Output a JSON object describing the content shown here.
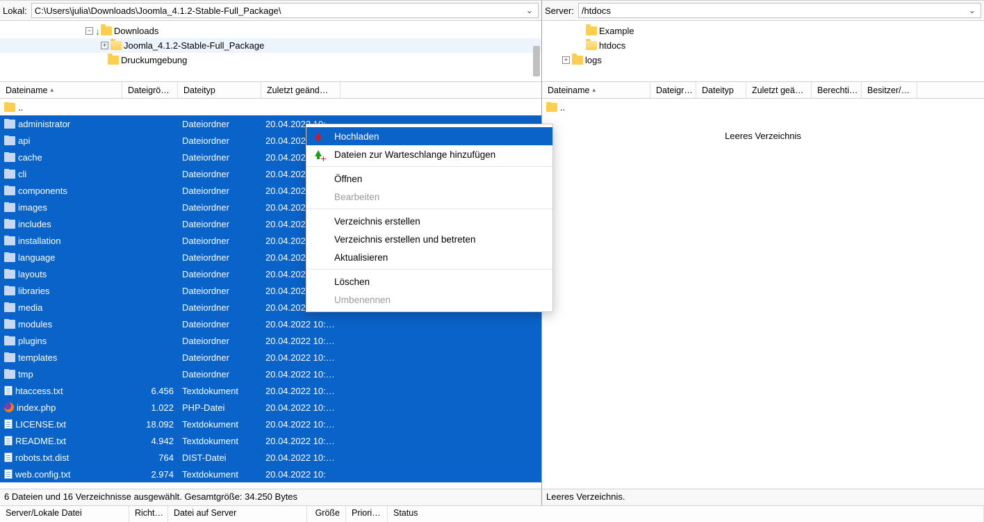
{
  "local": {
    "path_label": "Lokal:",
    "path": "C:\\Users\\julia\\Downloads\\Joomla_4.1.2-Stable-Full_Package\\",
    "tree": [
      {
        "indent": 120,
        "twist": "−",
        "dl": true,
        "label": "Downloads"
      },
      {
        "indent": 142,
        "twist": "+",
        "icon": "folder-open",
        "label": "Joomla_4.1.2-Stable-Full_Package",
        "selected": true
      },
      {
        "indent": 152,
        "label": "Druckumgebung"
      }
    ],
    "cols": {
      "name": "Dateiname",
      "size": "Dateigrö…",
      "type": "Dateityp",
      "modified": "Zuletzt geänd…"
    },
    "parent_row": "..",
    "rows": [
      {
        "icon": "folder",
        "name": "administrator",
        "type": "Dateiordner",
        "mod": "20.04.2022 10:"
      },
      {
        "icon": "folder",
        "name": "api",
        "type": "Dateiordner",
        "mod": "20.04.202"
      },
      {
        "icon": "folder",
        "name": "cache",
        "type": "Dateiordner",
        "mod": "20.04.202"
      },
      {
        "icon": "folder",
        "name": "cli",
        "type": "Dateiordner",
        "mod": "20.04.202"
      },
      {
        "icon": "folder",
        "name": "components",
        "type": "Dateiordner",
        "mod": "20.04.202"
      },
      {
        "icon": "folder",
        "name": "images",
        "type": "Dateiordner",
        "mod": "20.04.202"
      },
      {
        "icon": "folder",
        "name": "includes",
        "type": "Dateiordner",
        "mod": "20.04.202"
      },
      {
        "icon": "folder",
        "name": "installation",
        "type": "Dateiordner",
        "mod": "20.04.202"
      },
      {
        "icon": "folder",
        "name": "language",
        "type": "Dateiordner",
        "mod": "20.04.202"
      },
      {
        "icon": "folder",
        "name": "layouts",
        "type": "Dateiordner",
        "mod": "20.04.202"
      },
      {
        "icon": "folder",
        "name": "libraries",
        "type": "Dateiordner",
        "mod": "20.04.202"
      },
      {
        "icon": "folder",
        "name": "media",
        "type": "Dateiordner",
        "mod": "20.04.202"
      },
      {
        "icon": "folder",
        "name": "modules",
        "type": "Dateiordner",
        "mod": "20.04.2022 10:…"
      },
      {
        "icon": "folder",
        "name": "plugins",
        "type": "Dateiordner",
        "mod": "20.04.2022 10:…"
      },
      {
        "icon": "folder",
        "name": "templates",
        "type": "Dateiordner",
        "mod": "20.04.2022 10:…"
      },
      {
        "icon": "folder",
        "name": "tmp",
        "type": "Dateiordner",
        "mod": "20.04.2022 10:…"
      },
      {
        "icon": "file",
        "name": "htaccess.txt",
        "size": "6.456",
        "type": "Textdokument",
        "mod": "20.04.2022 10:…"
      },
      {
        "icon": "ff",
        "name": "index.php",
        "size": "1.022",
        "type": "PHP-Datei",
        "mod": "20.04.2022 10:…"
      },
      {
        "icon": "file",
        "name": "LICENSE.txt",
        "size": "18.092",
        "type": "Textdokument",
        "mod": "20.04.2022 10:…"
      },
      {
        "icon": "file",
        "name": "README.txt",
        "size": "4.942",
        "type": "Textdokument",
        "mod": "20.04.2022 10:…"
      },
      {
        "icon": "file",
        "name": "robots.txt.dist",
        "size": "764",
        "type": "DIST-Datei",
        "mod": "20.04.2022 10:…"
      },
      {
        "icon": "file",
        "name": "web.config.txt",
        "size": "2.974",
        "type": "Textdokument",
        "mod": "20.04.2022 10:"
      }
    ],
    "status": "6 Dateien und 16 Verzeichnisse ausgewählt. Gesamtgröße: 34.250 Bytes"
  },
  "server": {
    "path_label": "Server:",
    "path": "/htdocs",
    "tree": [
      {
        "indent": 44,
        "label": "Example"
      },
      {
        "indent": 44,
        "icon": "folder-open",
        "label": "htdocs"
      },
      {
        "indent": 26,
        "twist": "+",
        "label": "logs"
      }
    ],
    "cols": {
      "name": "Dateiname",
      "size": "Dateigr…",
      "type": "Dateityp",
      "modified": "Zuletzt geä…",
      "perm": "Berechti…",
      "owner": "Besitzer/…"
    },
    "parent_row": "..",
    "empty": "Leeres Verzeichnis",
    "status": "Leeres Verzeichnis."
  },
  "context_menu": {
    "upload": "Hochladen",
    "add_queue": "Dateien zur Warteschlange hinzufügen",
    "open": "Öffnen",
    "edit": "Bearbeiten",
    "mkdir": "Verzeichnis erstellen",
    "mkdir_enter": "Verzeichnis erstellen und betreten",
    "refresh": "Aktualisieren",
    "delete": "Löschen",
    "rename": "Umbenennen"
  },
  "queue_cols": {
    "serverfile": "Server/Lokale Datei",
    "direction": "Richt…",
    "remotefile": "Datei auf Server",
    "size": "Größe",
    "prio": "Priori…",
    "status": "Status"
  }
}
